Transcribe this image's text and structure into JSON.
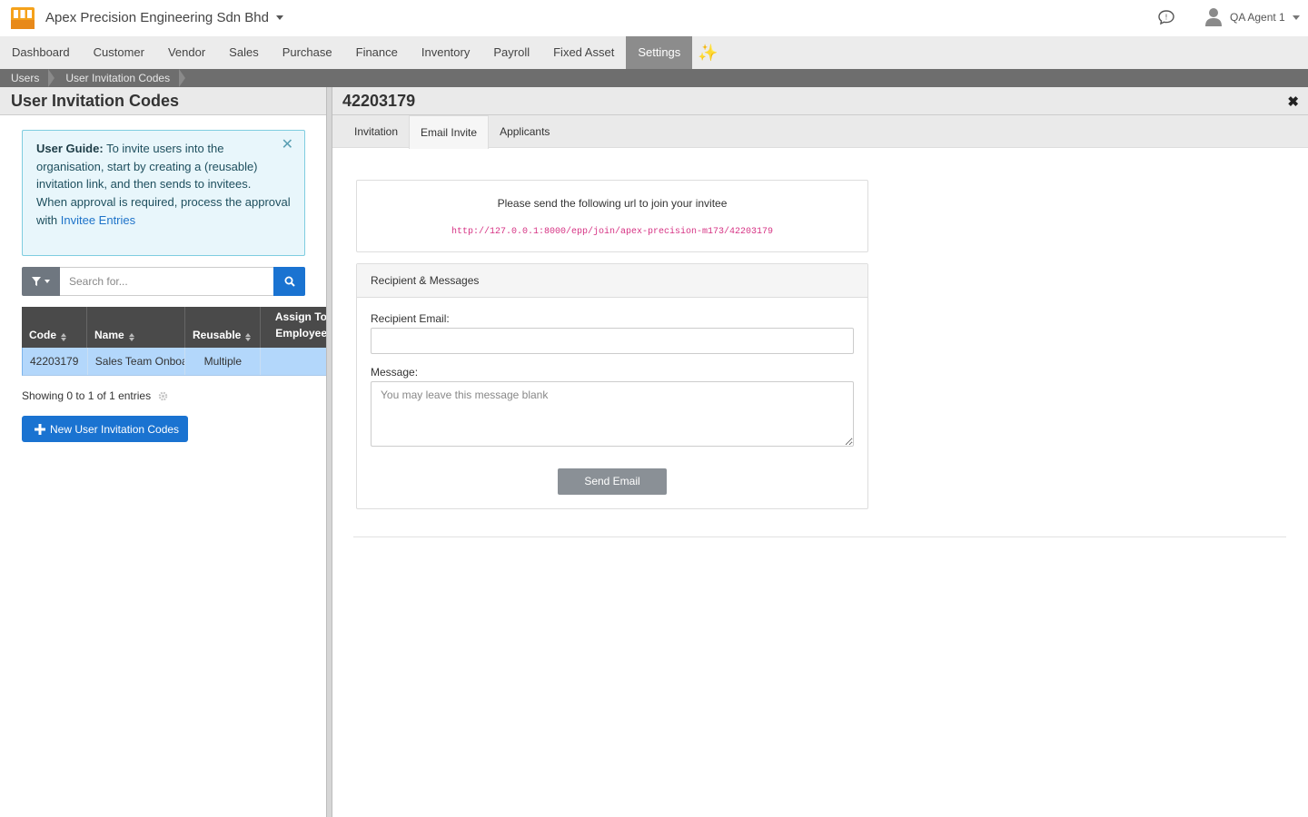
{
  "header": {
    "company_name": "Apex Precision Engineering Sdn Bhd",
    "user_name": "QA Agent 1"
  },
  "nav": {
    "items": [
      "Dashboard",
      "Customer",
      "Vendor",
      "Sales",
      "Purchase",
      "Finance",
      "Inventory",
      "Payroll",
      "Fixed Asset",
      "Settings"
    ],
    "active": "Settings",
    "sparkle_icon": "sparkle-icon"
  },
  "breadcrumb": [
    "Users",
    "User Invitation Codes"
  ],
  "left_panel": {
    "title": "User Invitation Codes",
    "guide": {
      "label": "User Guide:",
      "text1": "To invite users into the organisation, start by creating a (reusable) invitation link, and then sends to invitees.",
      "text2": "When approval is required, process the approval with",
      "link": "Invitee Entries"
    },
    "search": {
      "placeholder": "Search for..."
    },
    "table": {
      "columns": [
        "Code",
        "Name",
        "Reusable",
        "Assign To Employee"
      ],
      "rows": [
        {
          "code": "42203179",
          "name": "Sales Team Onboarding",
          "reusable": "Multiple",
          "assign": ""
        }
      ]
    },
    "showing": "Showing 0 to 1 of 1 entries",
    "new_button": "New User Invitation Codes"
  },
  "right_panel": {
    "title": "42203179",
    "tabs": [
      "Invitation",
      "Email Invite",
      "Applicants"
    ],
    "active_tab": "Email Invite",
    "url_card": {
      "title": "Please send the following url to join your invitee",
      "url": "http://127.0.0.1:8000/epp/join/apex-precision-m173/42203179"
    },
    "message_card": {
      "header": "Recipient & Messages",
      "email_label": "Recipient Email:",
      "email_value": "",
      "message_label": "Message:",
      "message_placeholder": "You may leave this message blank",
      "send_button": "Send Email"
    }
  },
  "colors": {
    "primary": "#1a73d1",
    "nav_active": "#8c8c8c",
    "selected_row": "#b3d7fb",
    "url_text": "#d63384"
  }
}
